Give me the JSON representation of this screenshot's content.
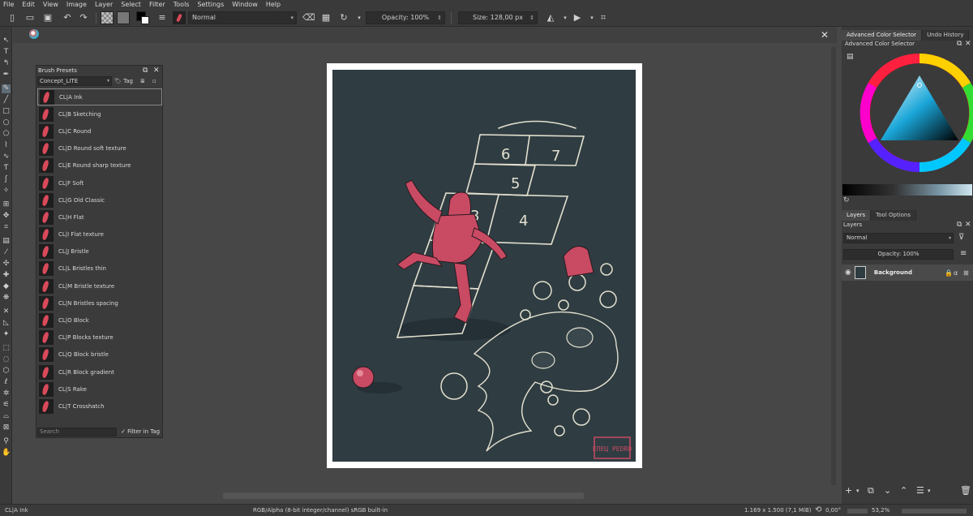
{
  "menu": [
    "File",
    "Edit",
    "View",
    "Image",
    "Layer",
    "Select",
    "Filter",
    "Tools",
    "Settings",
    "Window",
    "Help"
  ],
  "toolbar": {
    "blend_mode": "Normal",
    "opacity": "Opacity: 100%",
    "size": "Size: 128,00 px"
  },
  "brush_presets": {
    "title": "Brush Presets",
    "set": "Concept_LITE",
    "tag_label": "Tag",
    "items": [
      "CL|A Ink",
      "CL|B Sketching",
      "CL|C Round",
      "CL|D Round soft texture",
      "CL|E Round sharp texture",
      "CL|F Soft",
      "CL|G Old Classic",
      "CL|H Flat",
      "CL|I Flat texture",
      "CL|J Bristle",
      "CL|L Bristles thin",
      "CL|M Bristle texture",
      "CL|N Bristles spacing",
      "CL|O Block",
      "CL|P Blocks texture",
      "CL|Q Block bristle",
      "CL|R Block gradient",
      "CL|S Rake",
      "CL|T Crosshatch"
    ],
    "search_placeholder": "Search",
    "filter_label": "Filter in Tag"
  },
  "dock": {
    "top_tabs": [
      "Advanced Color Selector",
      "Undo History"
    ],
    "color_selector_title": "Advanced Color Selector",
    "layer_tabs": [
      "Layers",
      "Tool Options"
    ],
    "layers_title": "Layers",
    "layer_blend": "Normal",
    "layer_opacity": "Opacity: 100%",
    "layer_name": "Background"
  },
  "artwork": {
    "hopscotch_numbers": [
      "6",
      "7",
      "5",
      "3",
      "4"
    ],
    "signature": "ЕПЕЦ PEDRO"
  },
  "statusbar": {
    "brush": "CL|A Ink",
    "color_space": "RGB/Alpha (8-bit integer/channel)  sRGB built-in",
    "dimensions": "1.169 x 1.500 (7,1 MiB)",
    "rotation": "0,00°",
    "zoom": "53,2%"
  },
  "colors": {
    "canvas_bg": "#2f3d42",
    "figure": "#c94a63",
    "chalk": "#e3e0cf",
    "ui_dark": "#3a3a3a"
  }
}
